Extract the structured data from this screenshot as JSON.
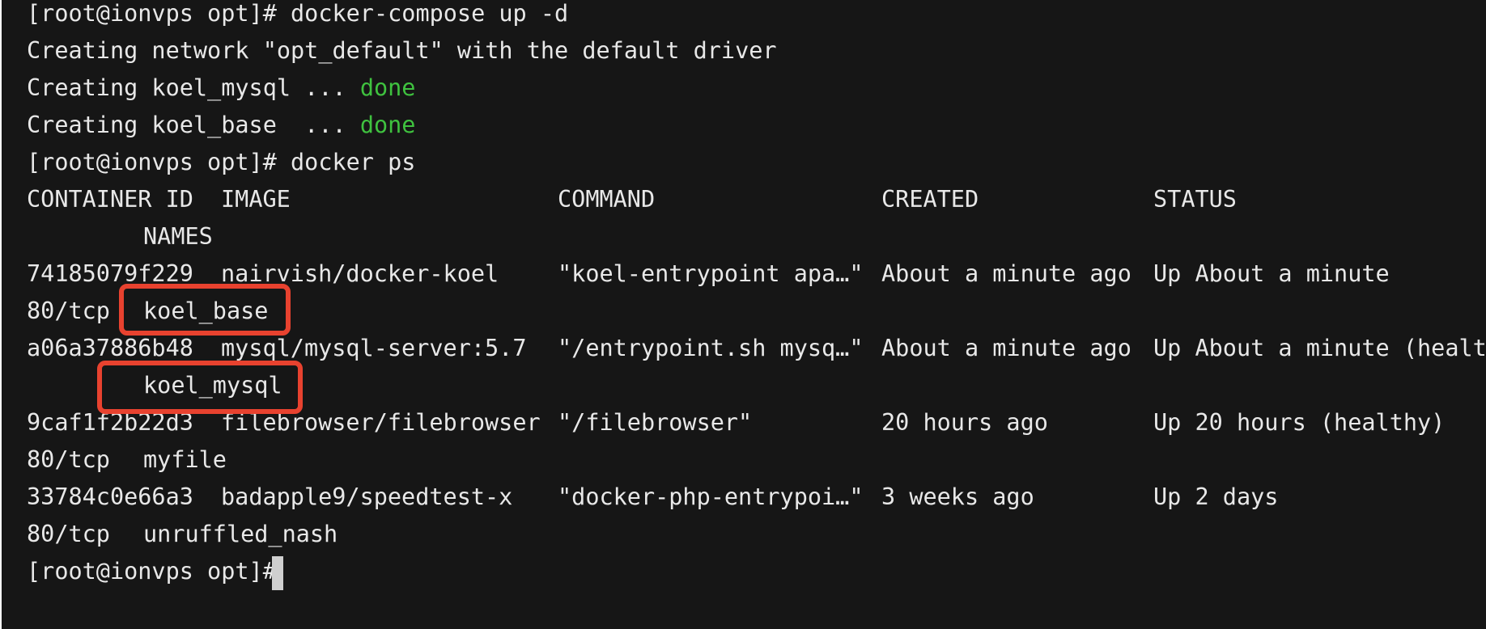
{
  "terminal": {
    "prompt": "[root@ionvps opt]# ",
    "commands": {
      "compose": "docker-compose up -d",
      "ps": "docker ps"
    },
    "compose_output": {
      "network": "Creating network \"opt_default\" with the default driver",
      "mysql_prefix": "Creating koel_mysql ... ",
      "base_prefix": "Creating koel_base  ... ",
      "done": "done"
    },
    "ps_table": {
      "headers": {
        "container_id": "CONTAINER ID",
        "image": "IMAGE",
        "command": "COMMAND",
        "created": "CREATED",
        "status": "STATUS",
        "names": "NAMES"
      },
      "rows": [
        {
          "id": "74185079f229",
          "image": "nairvish/docker-koel",
          "command": "\"koel-entrypoint apa…\"",
          "created": "About a minute ago",
          "status": "Up About a minute",
          "ports": "80/tcp",
          "name": "koel_base"
        },
        {
          "id": "a06a37886b48",
          "image": "mysql/mysql-server:5.7",
          "command": "\"/entrypoint.sh mysq…\"",
          "created": "About a minute ago",
          "status": "Up About a minute (healthy",
          "ports": "",
          "name": "koel_mysql"
        },
        {
          "id": "9caf1f2b22d3",
          "image": "filebrowser/filebrowser",
          "command": "\"/filebrowser\"",
          "created": "20 hours ago",
          "status": "Up 20 hours (healthy)",
          "ports": "80/tcp",
          "name": "myfile"
        },
        {
          "id": "33784c0e66a3",
          "image": "badapple9/speedtest-x",
          "command": "\"docker-php-entrypoi…\"",
          "created": "3 weeks ago",
          "status": "Up 2 days",
          "ports": "80/tcp",
          "name": "unruffled_nash"
        }
      ]
    },
    "colors": {
      "background": "#161616",
      "text": "#e8e8e8",
      "done": "#3fc23f",
      "highlight": "#e8422f"
    }
  }
}
